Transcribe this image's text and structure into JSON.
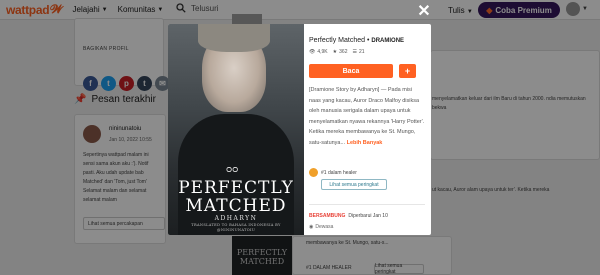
{
  "nav": {
    "logo": "wattpad",
    "jelajahi": "Jelajahi",
    "komunitas": "Komunitas",
    "search_placeholder": "Telusuri",
    "tulis": "Tulis",
    "premium": "Coba Premium"
  },
  "background": {
    "share_label": "BAGIKAN PROFIL",
    "share_icons": [
      "f",
      "t",
      "p",
      "t",
      "e"
    ],
    "pesan_title": "Pesan terakhir",
    "msg_user": "nininunatoiu",
    "msg_date": "Jan 10, 2022 10:55",
    "msg_lines": [
      "Sepertinya wattpad malam ini",
      "sensi sama akun aku :'). Notif",
      "pasti. Aku udah update bab",
      "Matched' dan 'Tom, just Tom'",
      "Selamat malam dan selamat",
      "selamat malam"
    ],
    "msg_replies": "Lihat semua percakapan",
    "right_text": "menyelamatkan keluar dari ilm Baru di tahun 2000. ndia memutuskan bekwa",
    "right_lower": "ut kacau, Auror alam upaya untuk ter'. Ketika mereka",
    "lower_text": "membawanya ke St. Mungo, satu-s...",
    "lower_author": "#1 DALAM HEALER",
    "lower_btn": "Lihat semua peringkat",
    "thumb_text": "PERFECTLY MATCHED"
  },
  "modal": {
    "cover": {
      "title_line1": "PERFECTLY",
      "title_line2": "MATCHED",
      "author": "ADHARYN",
      "sub_line1": "TRANSLATED TO BAHASA INDONESIA BY",
      "sub_line2": "@NININUNATOIU"
    },
    "title": "Perfectly Matched",
    "author": "DRAMIONE",
    "reads": "4,9K",
    "votes": "362",
    "parts": "21",
    "read_button": "Baca",
    "add_button": "+",
    "description": "[Dramione Story by Adharyn] — Pada misi naas yang kacau, Auror Draco Malfoy disiksa oleh manusia serigala dalam upaya untuk menyelamatkan nyawa rekannya 'Harry Potter'. Ketika mereka membawanya ke St. Mungo, satu-satunya...",
    "more_link": "Lebih Banyak",
    "rank_text": "#1 dalam healer",
    "rank_button": "Lihat semua peringkat",
    "ongoing_tag": "BERSAMBUNG",
    "ongoing_date": "Diperbarui Jan 10",
    "mature": "Dewasa"
  },
  "colors": {
    "accent": "#ff6122",
    "premium": "#36175e",
    "facebook": "#3b5998",
    "twitter": "#1da1f2",
    "pinterest": "#cb2027",
    "tumblr": "#35465c",
    "email": "#7b8894"
  }
}
